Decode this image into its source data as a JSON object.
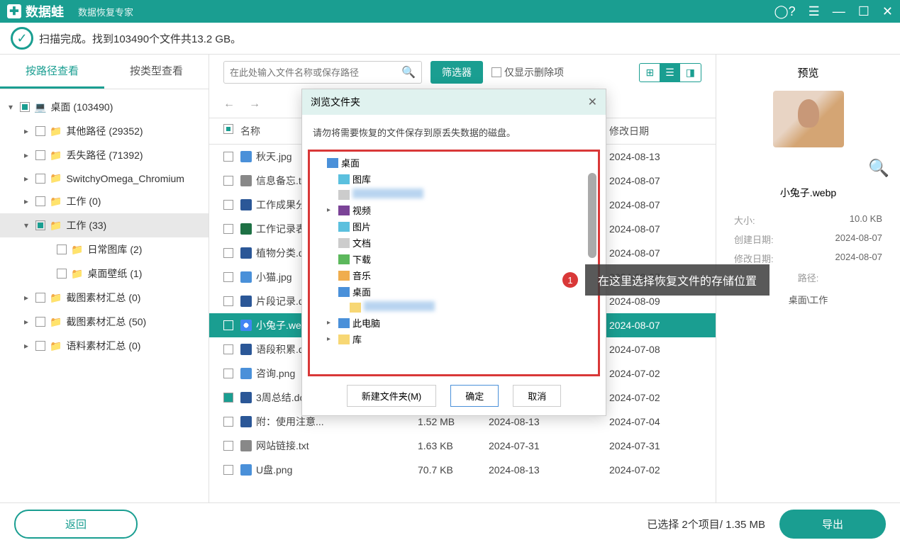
{
  "app": {
    "name": "数据蛙",
    "subtitle": "数据恢复专家"
  },
  "status": "扫描完成。找到103490个文件共13.2 GB。",
  "tabs": {
    "byPath": "按路径查看",
    "byType": "按类型查看"
  },
  "tree": [
    {
      "label": "桌面 (103490)",
      "indent": 0,
      "chev": "▾",
      "half": true,
      "icon": "💻"
    },
    {
      "label": "其他路径 (29352)",
      "indent": 1,
      "chev": "▸",
      "half": false
    },
    {
      "label": "丢失路径 (71392)",
      "indent": 1,
      "chev": "▸",
      "half": false
    },
    {
      "label": "SwitchyOmega_Chromium",
      "indent": 1,
      "chev": "▸",
      "half": false
    },
    {
      "label": "工作 (0)",
      "indent": 1,
      "chev": "▸",
      "half": false
    },
    {
      "label": "工作 (33)",
      "indent": 1,
      "chev": "▾",
      "half": true,
      "selected": true
    },
    {
      "label": "日常图库 (2)",
      "indent": 2,
      "chev": "",
      "half": false
    },
    {
      "label": "桌面壁纸 (1)",
      "indent": 2,
      "chev": "",
      "half": false
    },
    {
      "label": "截图素材汇总 (0)",
      "indent": 1,
      "chev": "▸",
      "half": false
    },
    {
      "label": "截图素材汇总 (50)",
      "indent": 1,
      "chev": "▸",
      "half": false
    },
    {
      "label": "语料素材汇总 (0)",
      "indent": 1,
      "chev": "▸",
      "half": false
    }
  ],
  "toolbar": {
    "searchPlaceholder": "在此处输入文件名称或保存路径",
    "filter": "筛选器",
    "onlyDeleted": "仅显示删除项"
  },
  "cols": {
    "name": "名称",
    "mod": "修改日期"
  },
  "files": [
    {
      "name": "秋天.jpg",
      "ic": "ic-img",
      "size": "",
      "d1": "",
      "d2": "2024-08-13",
      "ck": false
    },
    {
      "name": "信息备忘.t",
      "ic": "ic-txt",
      "size": "",
      "d1": "",
      "d2": "2024-08-07",
      "ck": false
    },
    {
      "name": "工作成果分",
      "ic": "ic-doc",
      "size": "",
      "d1": "",
      "d2": "2024-08-07",
      "ck": false
    },
    {
      "name": "工作记录表",
      "ic": "ic-xls",
      "size": "",
      "d1": "",
      "d2": "2024-08-07",
      "ck": false
    },
    {
      "name": "植物分类.d",
      "ic": "ic-doc",
      "size": "",
      "d1": "",
      "d2": "2024-08-07",
      "ck": false
    },
    {
      "name": "小猫.jpg",
      "ic": "ic-img",
      "size": "",
      "d1": "",
      "d2": "2024-08-07",
      "ck": false
    },
    {
      "name": "片段记录.d",
      "ic": "ic-doc",
      "size": "",
      "d1": "",
      "d2": "2024-08-09",
      "ck": false
    },
    {
      "name": "小兔子.we",
      "ic": "ic-chrome",
      "size": "",
      "d1": "",
      "d2": "2024-08-07",
      "ck": true,
      "sel": true
    },
    {
      "name": "语段积累.d",
      "ic": "ic-doc",
      "size": "",
      "d1": "",
      "d2": "2024-07-08",
      "ck": false
    },
    {
      "name": "咨询.png",
      "ic": "ic-img",
      "size": "",
      "d1": "",
      "d2": "2024-07-02",
      "ck": false
    },
    {
      "name": "3周总结.do",
      "ic": "ic-doc",
      "size": "",
      "d1": "",
      "d2": "2024-07-02",
      "ck": true
    },
    {
      "name": "附：使用注意...",
      "ic": "ic-doc",
      "size": "1.52 MB",
      "d1": "2024-08-13",
      "d2": "2024-07-04",
      "ck": false
    },
    {
      "name": "网站链接.txt",
      "ic": "ic-txt",
      "size": "1.63 KB",
      "d1": "2024-07-31",
      "d2": "2024-07-31",
      "ck": false
    },
    {
      "name": "U盘.png",
      "ic": "ic-img",
      "size": "70.7 KB",
      "d1": "2024-08-13",
      "d2": "2024-07-02",
      "ck": false
    }
  ],
  "preview": {
    "title": "预览",
    "filename": "小兔子.webp",
    "meta": {
      "sizeK": "大小:",
      "sizeV": "10.0 KB",
      "createK": "创建日期:",
      "createV": "2024-08-07",
      "modK": "修改日期:",
      "modV": "2024-08-07",
      "pathK": "路径:",
      "pathV": "桌面\\工作"
    }
  },
  "footer": {
    "back": "返回",
    "status": "已选择 2个项目/ 1.35 MB",
    "export": "导出"
  },
  "dialog": {
    "title": "浏览文件夹",
    "msg": "请勿将需要恢复的文件保存到原丢失数据的磁盘。",
    "items": [
      {
        "label": "桌面",
        "ic": "dt-blue",
        "indent": 0,
        "chev": ""
      },
      {
        "label": "图库",
        "ic": "dt-cyan",
        "indent": 1,
        "chev": ""
      },
      {
        "label": "",
        "ic": "dt-gray",
        "indent": 1,
        "chev": "",
        "blur": true
      },
      {
        "label": "视频",
        "ic": "dt-purple",
        "indent": 1,
        "chev": "▸"
      },
      {
        "label": "图片",
        "ic": "dt-cyan",
        "indent": 1,
        "chev": ""
      },
      {
        "label": "文档",
        "ic": "dt-gray",
        "indent": 1,
        "chev": ""
      },
      {
        "label": "下载",
        "ic": "dt-green",
        "indent": 1,
        "chev": ""
      },
      {
        "label": "音乐",
        "ic": "dt-orange",
        "indent": 1,
        "chev": ""
      },
      {
        "label": "桌面",
        "ic": "dt-blue",
        "indent": 1,
        "chev": ""
      },
      {
        "label": "",
        "ic": "dt-yellow",
        "indent": 2,
        "chev": "",
        "blur": true
      },
      {
        "label": "此电脑",
        "ic": "dt-blue",
        "indent": 1,
        "chev": "▸"
      },
      {
        "label": "库",
        "ic": "dt-yellow",
        "indent": 1,
        "chev": "▸"
      }
    ],
    "newFolder": "新建文件夹(M)",
    "ok": "确定",
    "cancel": "取消"
  },
  "callout": {
    "num": "1",
    "text": "在这里选择恢复文件的存储位置"
  }
}
